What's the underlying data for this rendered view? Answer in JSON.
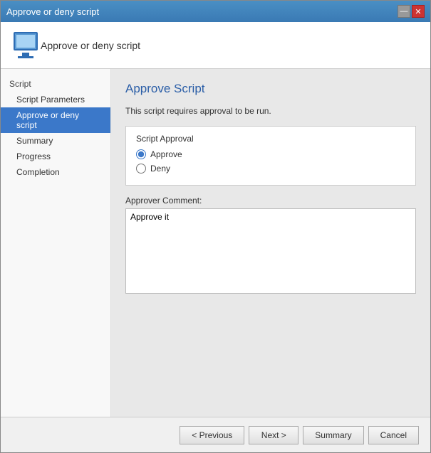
{
  "window": {
    "title": "Approve or deny script",
    "close_label": "✕",
    "minimize_label": "—"
  },
  "header": {
    "text": "Approve or deny script"
  },
  "sidebar": {
    "section_label": "Script",
    "items": [
      {
        "label": "Script Parameters",
        "active": false
      },
      {
        "label": "Approve or deny script",
        "active": true
      },
      {
        "label": "Summary",
        "active": false
      },
      {
        "label": "Progress",
        "active": false
      },
      {
        "label": "Completion",
        "active": false
      }
    ]
  },
  "main": {
    "title": "Approve Script",
    "description": "This script requires approval to be run.",
    "approval_group_label": "Script Approval",
    "approve_label": "Approve",
    "deny_label": "Deny",
    "comment_label": "Approver Comment:",
    "comment_value": "Approve it"
  },
  "footer": {
    "previous_label": "< Previous",
    "next_label": "Next >",
    "summary_label": "Summary",
    "cancel_label": "Cancel"
  }
}
